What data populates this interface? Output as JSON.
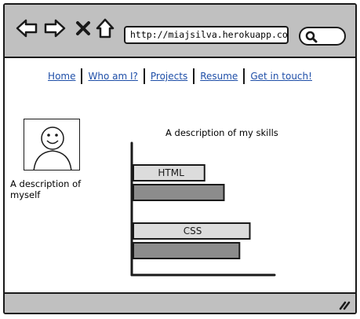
{
  "browser": {
    "url": "http://miajsilva.herokuapp.com/",
    "controls": [
      "back-arrow-icon",
      "forward-arrow-icon",
      "close-icon",
      "home-icon",
      "search-icon"
    ]
  },
  "nav": {
    "links": [
      "Home",
      "Who am I?",
      "Projects",
      "Resume",
      "Get in touch!"
    ]
  },
  "about": {
    "text": "A description of myself"
  },
  "skills": {
    "title": "A description of my skills"
  },
  "chart_data": {
    "type": "bar",
    "orientation": "horizontal",
    "categories": [
      "HTML",
      "CSS"
    ],
    "series": [
      {
        "values": [
          0.55,
          0.9
        ],
        "color": "#dcdcdc"
      },
      {
        "values": [
          0.7,
          0.82
        ],
        "color": "#8c8c8c"
      }
    ],
    "xlim": [
      0,
      1
    ],
    "grid": false,
    "colors": {
      "light": "#dcdcdc",
      "dark": "#8c8c8c"
    }
  },
  "theme": {
    "chrome": "#c0c0c0",
    "link": "#1f4fa8"
  }
}
